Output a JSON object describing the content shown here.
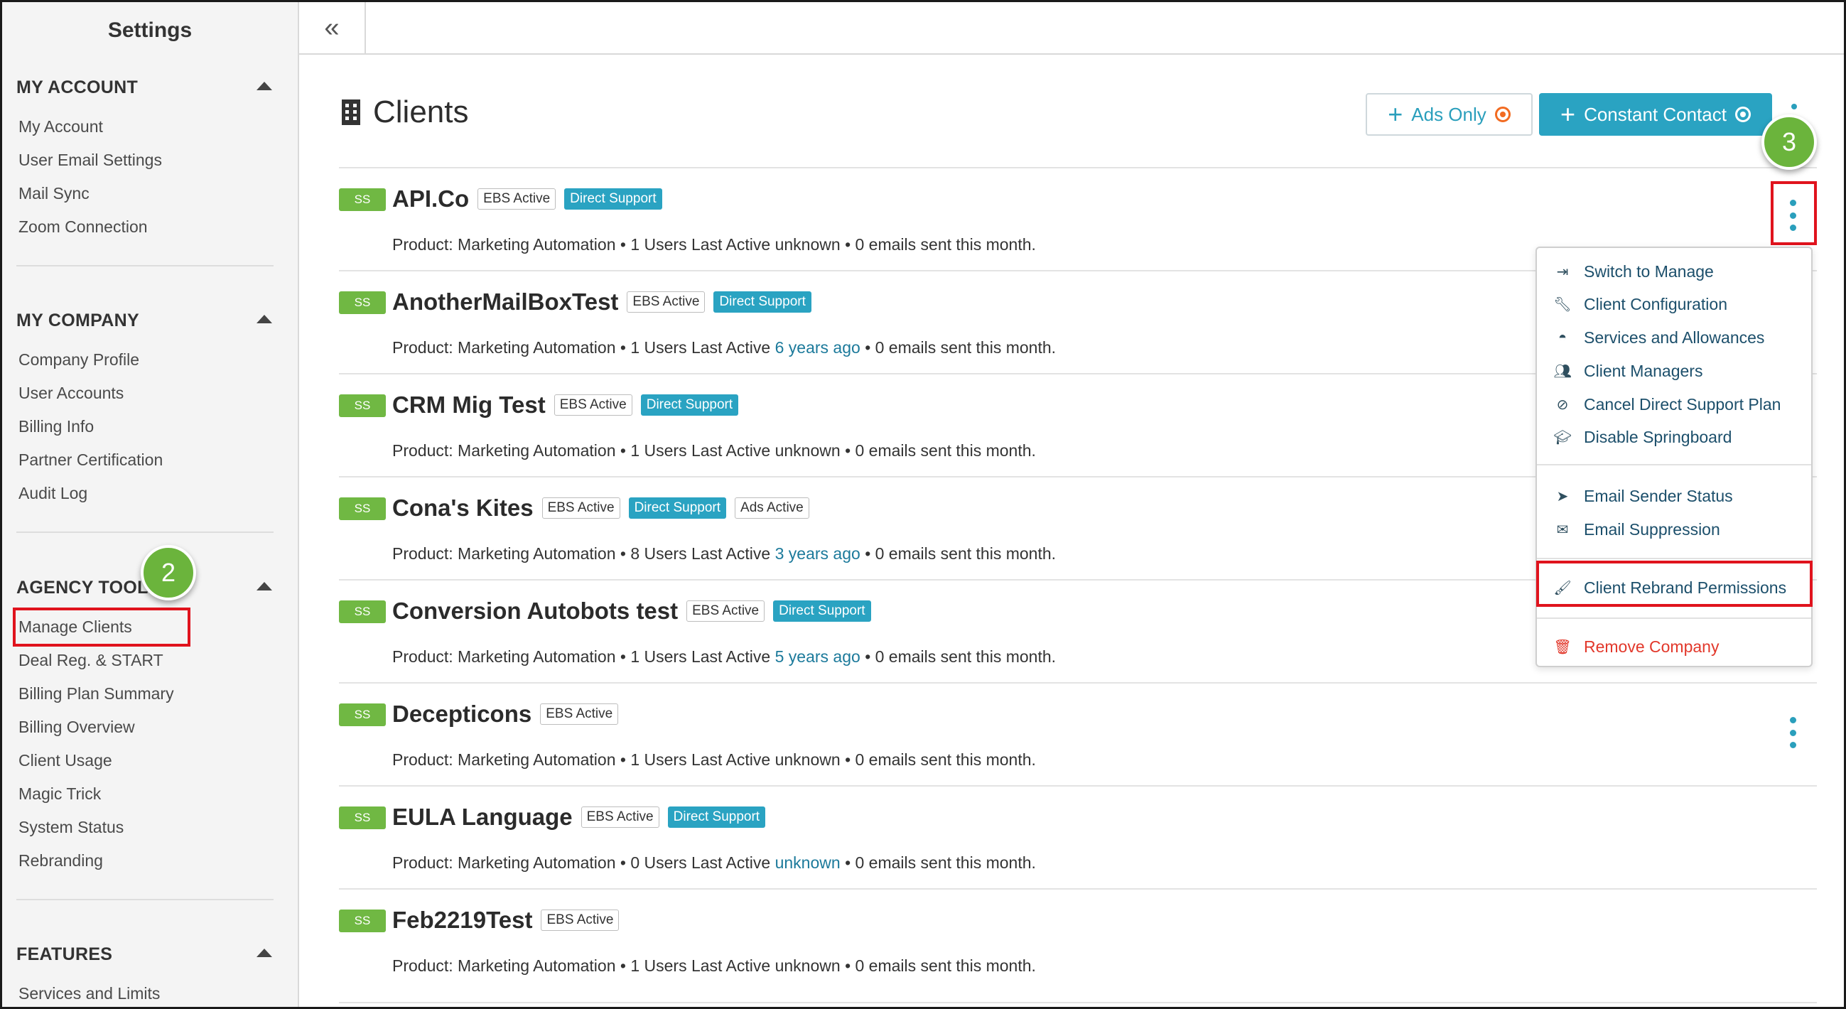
{
  "sidebar": {
    "title": "Settings",
    "sections": [
      {
        "heading": "MY ACCOUNT",
        "items": [
          "My Account",
          "User Email Settings",
          "Mail Sync",
          "Zoom Connection"
        ]
      },
      {
        "heading": "MY COMPANY",
        "items": [
          "Company Profile",
          "User Accounts",
          "Billing Info",
          "Partner Certification",
          "Audit Log"
        ]
      },
      {
        "heading": "AGENCY TOOLS",
        "items": [
          "Manage Clients",
          "Deal Reg. & START",
          "Billing Plan Summary",
          "Billing Overview",
          "Client Usage",
          "Magic Trick",
          "System Status",
          "Rebranding"
        ]
      },
      {
        "heading": "FEATURES",
        "items": [
          "Services and Limits"
        ]
      }
    ]
  },
  "topbar": {
    "collapse_icon": "«"
  },
  "page": {
    "title": "Clients",
    "ads_only_label": "Ads Only",
    "constant_contact_label": "Constant Contact"
  },
  "callouts": {
    "step2": "2",
    "step3": "3"
  },
  "clients": [
    {
      "badge": "SS",
      "name": "API.Co",
      "ebs": "EBS Active",
      "direct": "Direct Support",
      "ads": "",
      "product": "Product: Marketing Automation • 1 Users Last Active",
      "last_active": "unknown",
      "last_active_link": false,
      "emails": "• 0 emails sent this month."
    },
    {
      "badge": "SS",
      "name": "AnotherMailBoxTest",
      "ebs": "EBS Active",
      "direct": "Direct Support",
      "ads": "",
      "product": "Product: Marketing Automation • 1 Users Last Active",
      "last_active": "6 years ago",
      "last_active_link": true,
      "emails": "• 0 emails sent this month."
    },
    {
      "badge": "SS",
      "name": "CRM Mig Test",
      "ebs": "EBS Active",
      "direct": "Direct Support",
      "ads": "",
      "product": "Product: Marketing Automation • 1 Users Last Active",
      "last_active": "unknown",
      "last_active_link": false,
      "emails": "• 0 emails sent this month."
    },
    {
      "badge": "SS",
      "name": "Cona's Kites",
      "ebs": "EBS Active",
      "direct": "Direct Support",
      "ads": "Ads Active",
      "product": "Product: Marketing Automation • 8 Users Last Active",
      "last_active": "3 years ago",
      "last_active_link": true,
      "emails": "• 0 emails sent this month."
    },
    {
      "badge": "SS",
      "name": "Conversion Autobots test",
      "ebs": "EBS Active",
      "direct": "Direct Support",
      "ads": "",
      "product": "Product: Marketing Automation • 1 Users Last Active",
      "last_active": "5 years ago",
      "last_active_link": true,
      "emails": "• 0 emails sent this month."
    },
    {
      "badge": "SS",
      "name": "Decepticons",
      "ebs": "EBS Active",
      "direct": "",
      "ads": "",
      "product": "Product: Marketing Automation • 1 Users Last Active",
      "last_active": "unknown",
      "last_active_link": false,
      "emails": "• 0 emails sent this month."
    },
    {
      "badge": "SS",
      "name": "EULA Language",
      "ebs": "EBS Active",
      "direct": "Direct Support",
      "ads": "",
      "product": "Product: Marketing Automation • 0 Users Last Active",
      "last_active": "unknown",
      "last_active_link": true,
      "emails": "• 0 emails sent this month."
    },
    {
      "badge": "SS",
      "name": "Feb2219Test",
      "ebs": "EBS Active",
      "direct": "",
      "ads": "",
      "product": "Product: Marketing Automation • 1 Users Last Active",
      "last_active": "unknown",
      "last_active_link": false,
      "emails": "• 0 emails sent this month."
    }
  ],
  "dropdown": {
    "items": [
      {
        "label": "Switch to Manage",
        "icon": "sign-in-icon"
      },
      {
        "label": "Client Configuration",
        "icon": "wrench-icon"
      },
      {
        "label": "Services and Allowances",
        "icon": "gauge-icon"
      },
      {
        "label": "Client Managers",
        "icon": "users-icon"
      },
      {
        "label": "Cancel Direct Support Plan",
        "icon": "ban-icon"
      },
      {
        "label": "Disable Springboard",
        "icon": "graduation-cap-icon"
      },
      {
        "label": "Email Sender Status",
        "icon": "paper-plane-icon"
      },
      {
        "label": "Email Suppression",
        "icon": "envelope-icon"
      },
      {
        "label": "Client Rebrand Permissions",
        "icon": "paintbrush-icon"
      },
      {
        "label": "Remove Company",
        "icon": "trash-icon"
      }
    ]
  },
  "colors": {
    "accent": "#2aa3c2",
    "badge_green": "#70b843",
    "highlight_red": "#e0131d",
    "danger": "#e2382b",
    "callout_green": "#6bb43c"
  }
}
